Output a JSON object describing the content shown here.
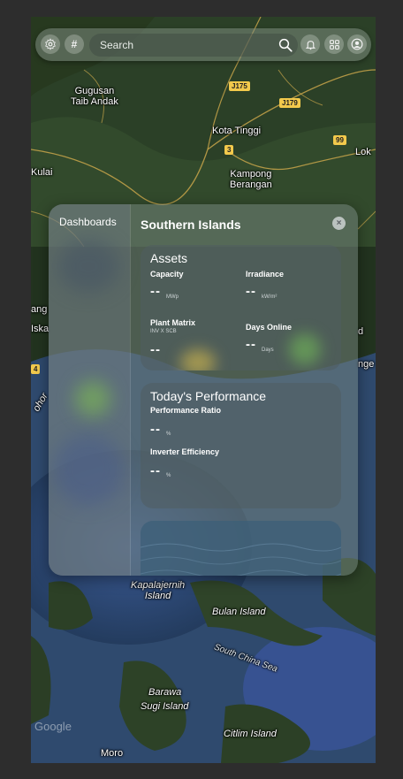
{
  "topbar": {
    "search_placeholder": "Search",
    "icons": [
      "gear-icon",
      "hash-icon",
      "search-icon",
      "bell-icon",
      "apps-grid-icon",
      "user-icon"
    ]
  },
  "map": {
    "labels": {
      "gugusan": "Gugusan\nTaib Andak",
      "kota_tinggi": "Kota Tinggi",
      "kampong": "Kampong\nBerangan",
      "kulai": "Kulai",
      "lok": "Lok",
      "kapalajernih": "Kapalajernih\nIsland",
      "bulan": "Bulan Island",
      "south_china_sea": "South China Sea",
      "barawa": "Barawa",
      "sugi": "Sugi Island",
      "citlim": "Citlim Island",
      "moro": "Moro",
      "ang": "ang",
      "iska": "Iska",
      "ohor": "ohor",
      "nge": "nge",
      "d_edge": "d"
    },
    "roads": {
      "j175": "J175",
      "j179": "J179",
      "r3": "3",
      "r99": "99",
      "r4": "4"
    },
    "attribution": "Google"
  },
  "panel": {
    "sidebar_title": "Dashboards",
    "title": "Southern Islands",
    "close_symbol": "×",
    "assets": {
      "title": "Assets",
      "capacity": {
        "label": "Capacity",
        "value": "--",
        "unit": "MWp"
      },
      "irradiance": {
        "label": "Irradiance",
        "value": "--",
        "unit": "kW/m²"
      },
      "plant_matrix": {
        "label": "Plant Matrix",
        "sub": "INV X SCB",
        "value": "--"
      },
      "days_online": {
        "label": "Days Online",
        "value": "--",
        "unit": "Days"
      }
    },
    "performance": {
      "title": "Today's Performance",
      "performance_ratio": {
        "label": "Performance Ratio",
        "value": "--",
        "unit": "%"
      },
      "inverter_efficiency": {
        "label": "Inverter Efficiency",
        "value": "--",
        "unit": "%"
      }
    }
  },
  "colors": {
    "accent_yellow": "#e8c64a",
    "accent_green": "#7ed957",
    "sea": "#2f4a6e"
  }
}
